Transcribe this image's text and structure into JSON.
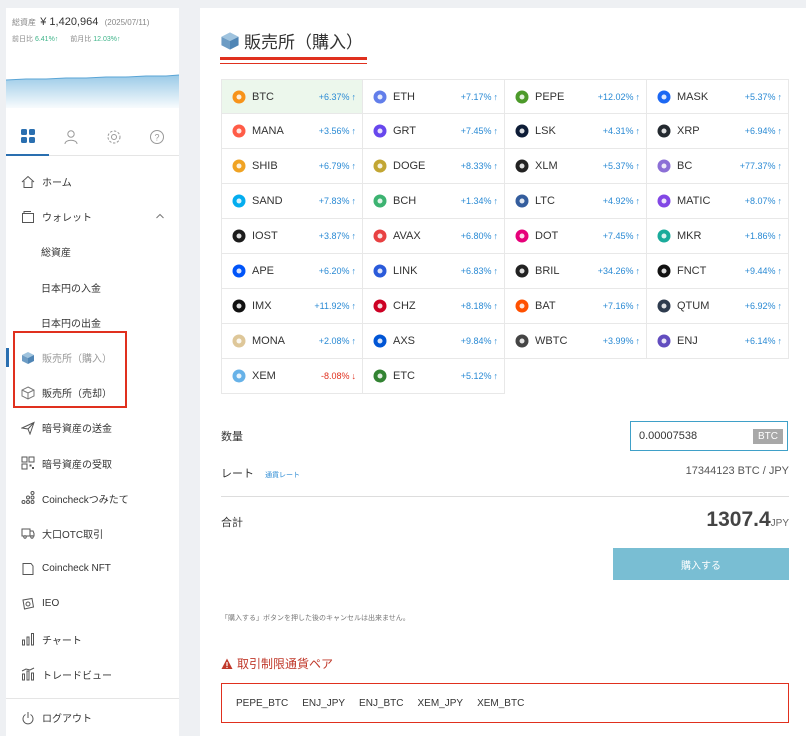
{
  "balance": {
    "label": "総資産",
    "amount": "¥ 1,420,964",
    "date": "(2025/07/11)",
    "day_label": "前日比",
    "day_change": "6.41%↑",
    "month_label": "前月比",
    "month_change": "12.03%↑"
  },
  "sidebar": {
    "tabs": [
      "grid-icon",
      "user-icon",
      "gear-icon",
      "help-icon"
    ],
    "items": [
      {
        "label": "ホーム",
        "icon": "home-icon"
      },
      {
        "label": "ウォレット",
        "icon": "wallet-icon"
      },
      {
        "label": "総資産",
        "icon": ""
      },
      {
        "label": "日本円の入金",
        "icon": ""
      },
      {
        "label": "日本円の出金",
        "icon": ""
      },
      {
        "label": "販売所（購入）",
        "icon": "cube-filled-icon"
      },
      {
        "label": "販売所（売却）",
        "icon": "cube-outline-icon"
      },
      {
        "label": "暗号資産の送金",
        "icon": "send-icon"
      },
      {
        "label": "暗号資産の受取",
        "icon": "qr-icon"
      },
      {
        "label": "Coincheckつみたて",
        "icon": "dots-icon"
      },
      {
        "label": "大口OTC取引",
        "icon": "truck-icon"
      },
      {
        "label": "Coincheck NFT",
        "icon": "nft-icon"
      },
      {
        "label": "IEO",
        "icon": "ieo-icon"
      },
      {
        "label": "チャート",
        "icon": "chart-icon"
      },
      {
        "label": "トレードビュー",
        "icon": "tradeview-icon"
      }
    ],
    "logout": "ログアウト"
  },
  "page": {
    "title": "販売所（購入）"
  },
  "coins": [
    {
      "sym": "BTC",
      "chg": "+6.37%",
      "dir": "up",
      "color": "#f7931a"
    },
    {
      "sym": "ETH",
      "chg": "+7.17%",
      "dir": "up",
      "color": "#627eea"
    },
    {
      "sym": "PEPE",
      "chg": "+12.02%",
      "dir": "up",
      "color": "#4c9a2a"
    },
    {
      "sym": "MASK",
      "chg": "+5.37%",
      "dir": "up",
      "color": "#1c68f3"
    },
    {
      "sym": "MANA",
      "chg": "+3.56%",
      "dir": "up",
      "color": "#ff5c47"
    },
    {
      "sym": "GRT",
      "chg": "+7.45%",
      "dir": "up",
      "color": "#6747ed"
    },
    {
      "sym": "LSK",
      "chg": "+4.31%",
      "dir": "up",
      "color": "#0d1c36"
    },
    {
      "sym": "XRP",
      "chg": "+6.94%",
      "dir": "up",
      "color": "#23292f"
    },
    {
      "sym": "SHIB",
      "chg": "+6.79%",
      "dir": "up",
      "color": "#f0a323"
    },
    {
      "sym": "DOGE",
      "chg": "+8.33%",
      "dir": "up",
      "color": "#c2a633"
    },
    {
      "sym": "XLM",
      "chg": "+5.37%",
      "dir": "up",
      "color": "#222222"
    },
    {
      "sym": "BC",
      "chg": "+77.37%",
      "dir": "up",
      "color": "#8c6fd6"
    },
    {
      "sym": "SAND",
      "chg": "+7.83%",
      "dir": "up",
      "color": "#04adef"
    },
    {
      "sym": "BCH",
      "chg": "+1.34%",
      "dir": "up",
      "color": "#3cb371"
    },
    {
      "sym": "LTC",
      "chg": "+4.92%",
      "dir": "up",
      "color": "#345d9d"
    },
    {
      "sym": "MATIC",
      "chg": "+8.07%",
      "dir": "up",
      "color": "#8247e5"
    },
    {
      "sym": "IOST",
      "chg": "+3.87%",
      "dir": "up",
      "color": "#1c1c1c"
    },
    {
      "sym": "AVAX",
      "chg": "+6.80%",
      "dir": "up",
      "color": "#e84142"
    },
    {
      "sym": "DOT",
      "chg": "+7.45%",
      "dir": "up",
      "color": "#e6007a"
    },
    {
      "sym": "MKR",
      "chg": "+1.86%",
      "dir": "up",
      "color": "#1aab9b"
    },
    {
      "sym": "APE",
      "chg": "+6.20%",
      "dir": "up",
      "color": "#0054f9"
    },
    {
      "sym": "LINK",
      "chg": "+6.83%",
      "dir": "up",
      "color": "#2a5ada"
    },
    {
      "sym": "BRIL",
      "chg": "+34.26%",
      "dir": "up",
      "color": "#222222"
    },
    {
      "sym": "FNCT",
      "chg": "+9.44%",
      "dir": "up",
      "color": "#111111"
    },
    {
      "sym": "IMX",
      "chg": "+11.92%",
      "dir": "up",
      "color": "#111111"
    },
    {
      "sym": "CHZ",
      "chg": "+8.18%",
      "dir": "up",
      "color": "#cd0124"
    },
    {
      "sym": "BAT",
      "chg": "+7.16%",
      "dir": "up",
      "color": "#ff5000"
    },
    {
      "sym": "QTUM",
      "chg": "+6.92%",
      "dir": "up",
      "color": "#2e3b4e"
    },
    {
      "sym": "MONA",
      "chg": "+2.08%",
      "dir": "up",
      "color": "#dec799"
    },
    {
      "sym": "AXS",
      "chg": "+9.84%",
      "dir": "up",
      "color": "#0055d5"
    },
    {
      "sym": "WBTC",
      "chg": "+3.99%",
      "dir": "up",
      "color": "#444444"
    },
    {
      "sym": "ENJ",
      "chg": "+6.14%",
      "dir": "up",
      "color": "#624dbf"
    },
    {
      "sym": "XEM",
      "chg": "-8.08%",
      "dir": "down",
      "color": "#67b2e8"
    },
    {
      "sym": "ETC",
      "chg": "+5.12%",
      "dir": "up",
      "color": "#328332"
    }
  ],
  "order": {
    "qty_label": "数量",
    "qty_value": "0.00007538",
    "qty_unit": "BTC",
    "rate_label": "レート",
    "rate_link": "通貨レート",
    "rate_value": "17344123  BTC / JPY",
    "total_label": "合計",
    "total_value": "1307.4",
    "total_unit": "JPY",
    "buy_button": "購入する",
    "note": "「購入する」ボタンを押した後のキャンセルは出来ません。"
  },
  "restricted": {
    "title": "取引制限通貨ペア",
    "pairs": [
      "PEPE_BTC",
      "ENJ_JPY",
      "ENJ_BTC",
      "XEM_JPY",
      "XEM_BTC"
    ]
  },
  "colors": {
    "accent_red": "#e0301e",
    "link_blue": "#2a8ad4",
    "buy_button": "#79bed3"
  }
}
